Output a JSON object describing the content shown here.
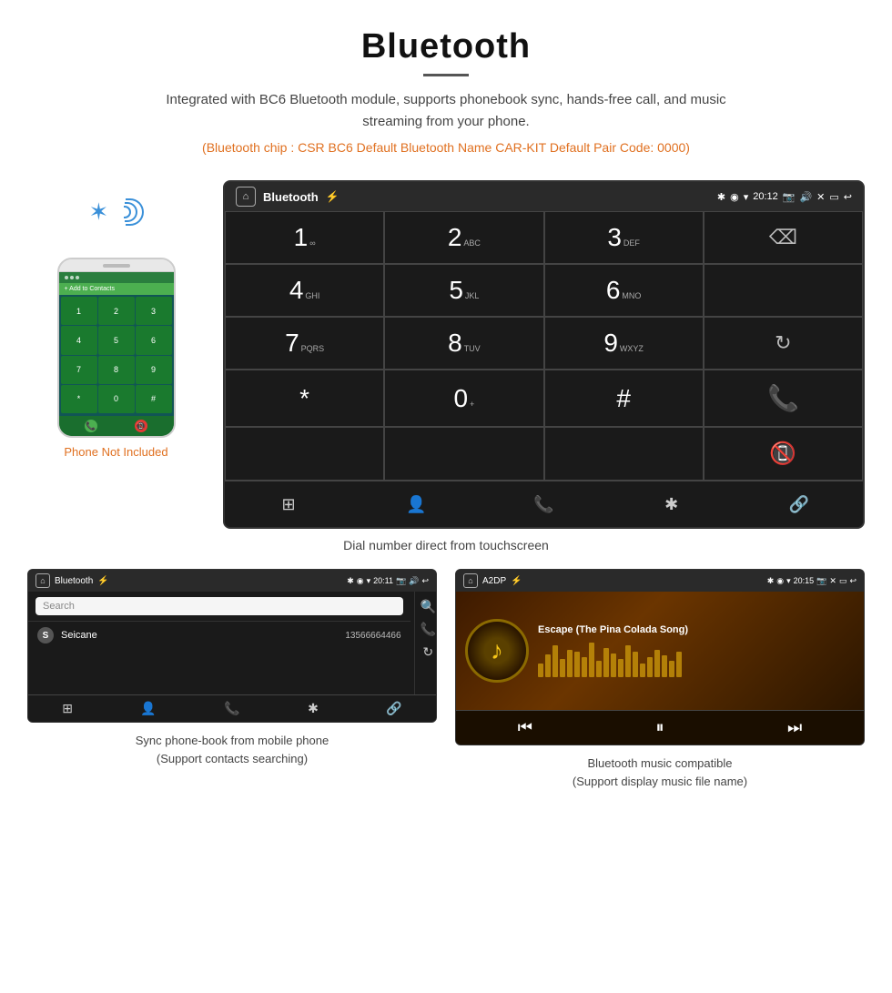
{
  "header": {
    "title": "Bluetooth",
    "description": "Integrated with BC6 Bluetooth module, supports phonebook sync, hands-free call, and music streaming from your phone.",
    "specs": "(Bluetooth chip : CSR BC6    Default Bluetooth Name CAR-KIT    Default Pair Code: 0000)",
    "phone_not_included": "Phone Not Included"
  },
  "car_screen": {
    "status_bar": {
      "title": "Bluetooth",
      "time": "20:12",
      "home_icon": "⌂",
      "usb_icon": "⚡",
      "bt_icon": "✱",
      "location_icon": "◉",
      "wifi_icon": "▾",
      "camera_icon": "📷",
      "volume_icon": "🔊",
      "close_icon": "✕",
      "screen_icon": "▭",
      "back_icon": "↩"
    },
    "keypad": {
      "rows": [
        [
          {
            "number": "1",
            "letters": "∞",
            "span": 1
          },
          {
            "number": "2",
            "letters": "ABC",
            "span": 1
          },
          {
            "number": "3",
            "letters": "DEF",
            "span": 1
          },
          {
            "number": "",
            "letters": "",
            "span": 1,
            "special": "backspace"
          }
        ],
        [
          {
            "number": "4",
            "letters": "GHI",
            "span": 1
          },
          {
            "number": "5",
            "letters": "JKL",
            "span": 1
          },
          {
            "number": "6",
            "letters": "MNO",
            "span": 1
          },
          {
            "number": "",
            "letters": "",
            "span": 1,
            "special": "empty"
          }
        ],
        [
          {
            "number": "7",
            "letters": "PQRS",
            "span": 1
          },
          {
            "number": "8",
            "letters": "TUV",
            "span": 1
          },
          {
            "number": "9",
            "letters": "WXYZ",
            "span": 1
          },
          {
            "number": "",
            "letters": "",
            "span": 1,
            "special": "refresh"
          }
        ],
        [
          {
            "number": "*",
            "letters": "",
            "span": 1
          },
          {
            "number": "0",
            "letters": "+",
            "span": 1
          },
          {
            "number": "#",
            "letters": "",
            "span": 1
          },
          {
            "number": "",
            "letters": "",
            "span": 1,
            "special": "call-green"
          }
        ],
        [
          {
            "number": "",
            "letters": "",
            "span": 1,
            "special": "end-call-red"
          }
        ]
      ]
    },
    "bottom_nav": [
      "⊞",
      "👤",
      "📞",
      "✱",
      "🔗"
    ],
    "caption": "Dial number direct from touchscreen"
  },
  "phonebook_screen": {
    "status_bar": {
      "title": "Bluetooth",
      "time": "20:11"
    },
    "search_placeholder": "Search",
    "contacts": [
      {
        "letter": "S",
        "name": "Seicane",
        "number": "13566664466"
      }
    ],
    "right_icons": [
      "🔍",
      "📞",
      "↻"
    ],
    "bottom_nav_icons": [
      "⊞",
      "👤",
      "📞",
      "✱",
      "🔗"
    ],
    "caption_line1": "Sync phone-book from mobile phone",
    "caption_line2": "(Support contacts searching)"
  },
  "music_screen": {
    "status_bar": {
      "title": "A2DP",
      "time": "20:15"
    },
    "song_title": "Escape (The Pina Colada Song)",
    "album_icon": "♪",
    "bt_icon": "✱",
    "visualizer_bars": [
      15,
      25,
      35,
      20,
      30,
      28,
      22,
      38,
      18,
      32,
      26,
      20,
      35,
      28,
      15,
      22,
      30,
      24,
      18,
      28
    ],
    "controls": [
      "⏮",
      "⏭|",
      "⏭"
    ],
    "caption_line1": "Bluetooth music compatible",
    "caption_line2": "(Support display music file name)"
  }
}
